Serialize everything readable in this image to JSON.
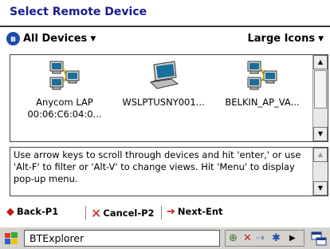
{
  "window": {
    "title": "Select Remote Device"
  },
  "filter": {
    "label": "All Devices"
  },
  "view": {
    "label": "Large Icons"
  },
  "devices": [
    {
      "name": "Anycom LAP",
      "address": "00:06:C6:04:0...",
      "icon": "network-computers-icon"
    },
    {
      "name": "WSLPTUSNY001...",
      "address": "",
      "icon": "laptop-icon"
    },
    {
      "name": "BELKIN_AP_VA...",
      "address": "",
      "icon": "network-computers-icon"
    }
  ],
  "help": {
    "text": "Use arrow keys to scroll through devices and hit 'enter,' or use 'Alt-F' to filter or 'Alt-V' to change views. Hit 'Menu' to display pop-up menu."
  },
  "commands": {
    "back": "Back-P1",
    "cancel": "Cancel-P2",
    "next": "Next-Ent"
  },
  "taskbar": {
    "active_app": "BTExplorer"
  },
  "colors": {
    "title": "#1a1a8f",
    "bluetooth": "#1b4eaa",
    "command_arrow": "#c41a1a",
    "taskbar": "#d6d3ce"
  }
}
